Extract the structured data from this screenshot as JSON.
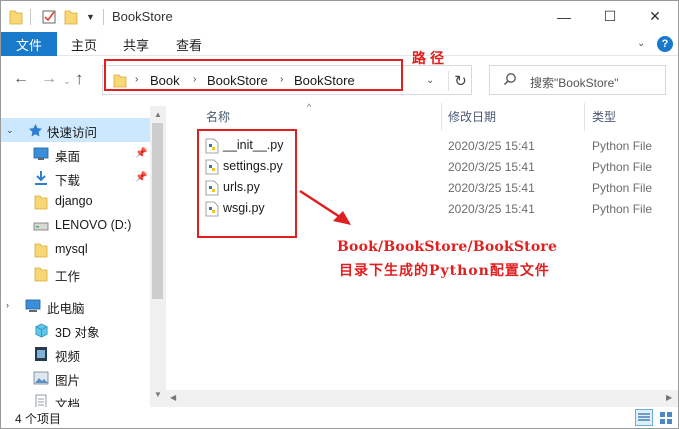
{
  "window": {
    "title": "BookStore",
    "controls": {
      "minimize": "—",
      "maximize": "☐",
      "close": "✕"
    }
  },
  "ribbon": {
    "tabs": [
      "文件",
      "主页",
      "共享",
      "查看"
    ],
    "help": "?"
  },
  "address": {
    "crumbs": [
      "Book",
      "BookStore",
      "BookStore"
    ],
    "annotation": "路径"
  },
  "search": {
    "placeholder": "搜索\"BookStore\""
  },
  "sidebar": {
    "quick_access": "快速访问",
    "items": [
      {
        "label": "桌面",
        "icon": "desktop-icon",
        "pinned": true
      },
      {
        "label": "下载",
        "icon": "download-icon",
        "pinned": true
      },
      {
        "label": "django",
        "icon": "folder-icon",
        "pinned": false
      },
      {
        "label": "LENOVO (D:)",
        "icon": "drive-icon",
        "pinned": false
      },
      {
        "label": "mysql",
        "icon": "folder-icon",
        "pinned": false
      },
      {
        "label": "工作",
        "icon": "folder-icon",
        "pinned": false
      }
    ],
    "this_pc": "此电脑",
    "pc_items": [
      {
        "label": "3D 对象",
        "icon": "3d-objects-icon"
      },
      {
        "label": "视频",
        "icon": "video-icon"
      },
      {
        "label": "图片",
        "icon": "pictures-icon"
      },
      {
        "label": "文档",
        "icon": "documents-icon"
      }
    ]
  },
  "columns": {
    "name": "名称",
    "date": "修改日期",
    "type": "类型"
  },
  "files": [
    {
      "name": "__init__.py",
      "date": "2020/3/25 15:41",
      "type": "Python File"
    },
    {
      "name": "settings.py",
      "date": "2020/3/25 15:41",
      "type": "Python File"
    },
    {
      "name": "urls.py",
      "date": "2020/3/25 15:41",
      "type": "Python File"
    },
    {
      "name": "wsgi.py",
      "date": "2020/3/25 15:41",
      "type": "Python File"
    }
  ],
  "annotation": {
    "line1": "Book/BookStore/BookStore",
    "line2": "目录下生成的Python配置文件"
  },
  "status": {
    "count": "4 个项目"
  },
  "colors": {
    "accent": "#1979ca",
    "annotation": "#e02020",
    "selected": "#cce8ff"
  }
}
